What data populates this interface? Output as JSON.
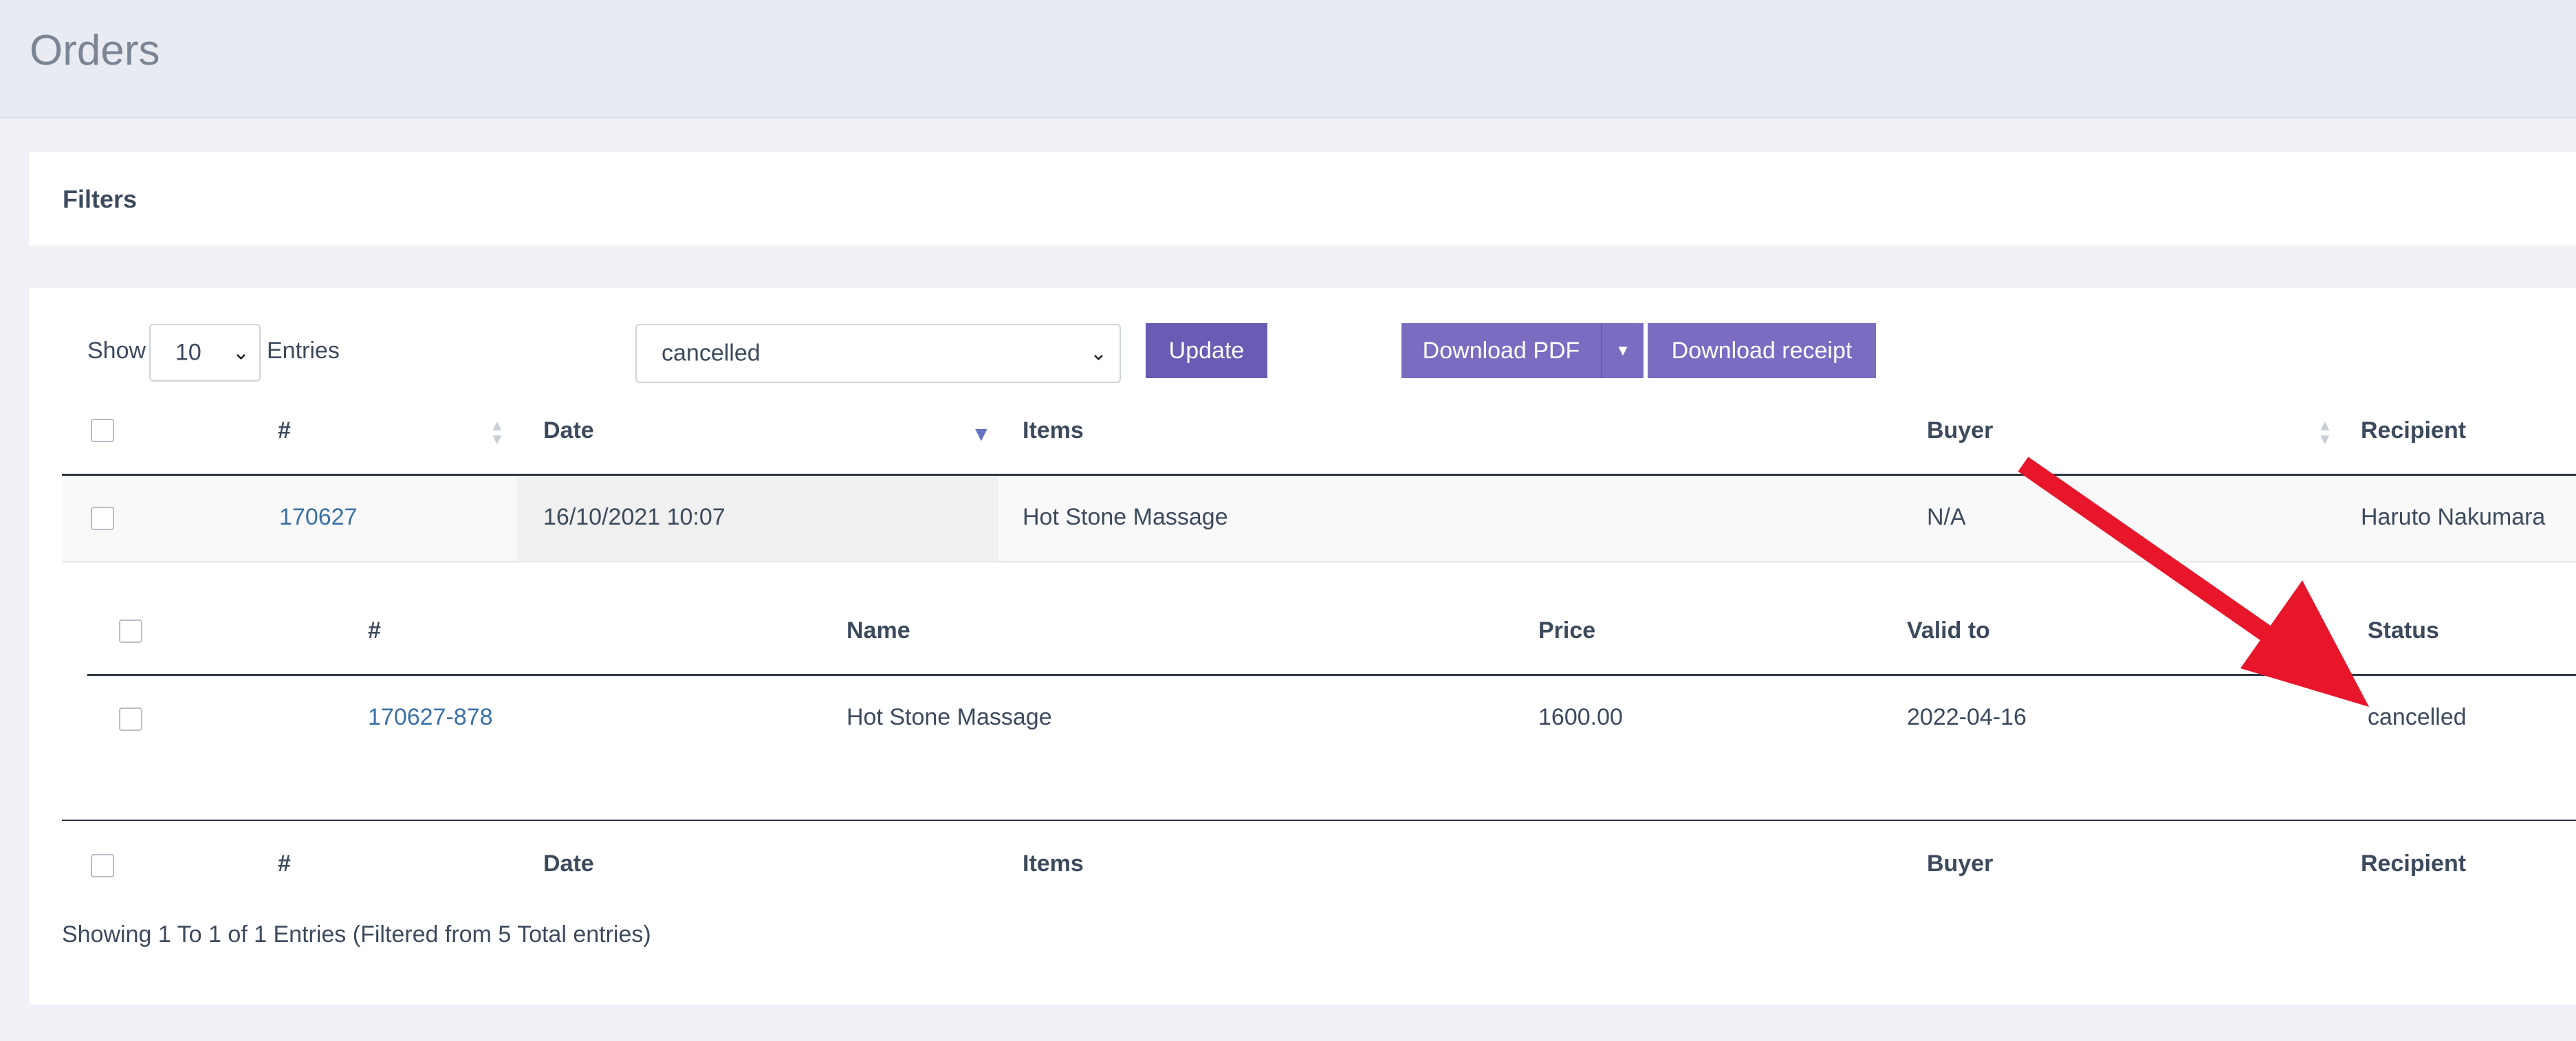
{
  "page": {
    "title": "Orders"
  },
  "filters": {
    "label": "Filters"
  },
  "controls": {
    "show_label": "Show",
    "entries_value": "10",
    "entries_label": "Entries",
    "status_value": "cancelled",
    "update_label": "Update",
    "download_pdf_label": "Download PDF",
    "download_receipt_label": "Download receipt"
  },
  "table": {
    "headers": {
      "number": "#",
      "date": "Date",
      "items": "Items",
      "buyer": "Buyer",
      "recipient": "Recipient"
    },
    "rows": [
      {
        "number": "170627",
        "date": "16/10/2021 10:07",
        "items": "Hot Stone Massage",
        "buyer": "N/A",
        "recipient": "Haruto Nakumara"
      }
    ],
    "footer": {
      "number": "#",
      "date": "Date",
      "items": "Items",
      "buyer": "Buyer",
      "recipient": "Recipient"
    }
  },
  "subtable": {
    "headers": {
      "number": "#",
      "name": "Name",
      "price": "Price",
      "valid_to": "Valid to",
      "status": "Status"
    },
    "rows": [
      {
        "number": "170627-878",
        "name": "Hot Stone Massage",
        "price": "1600.00",
        "valid_to": "2022-04-16",
        "status": "cancelled"
      }
    ]
  },
  "summary": "Showing 1 To 1 of 1 Entries (Filtered from 5 Total entries)",
  "colors": {
    "accent": "#7b6cc2",
    "accent_dark": "#6a5bb4",
    "link": "#3a70a8",
    "annotation_arrow": "#e8162b"
  },
  "icons": {
    "select_chevron": "chevron-down-icon",
    "sort": "sort-icon",
    "sort_active": "sort-desc-icon",
    "annotation": "red-arrow-icon"
  }
}
